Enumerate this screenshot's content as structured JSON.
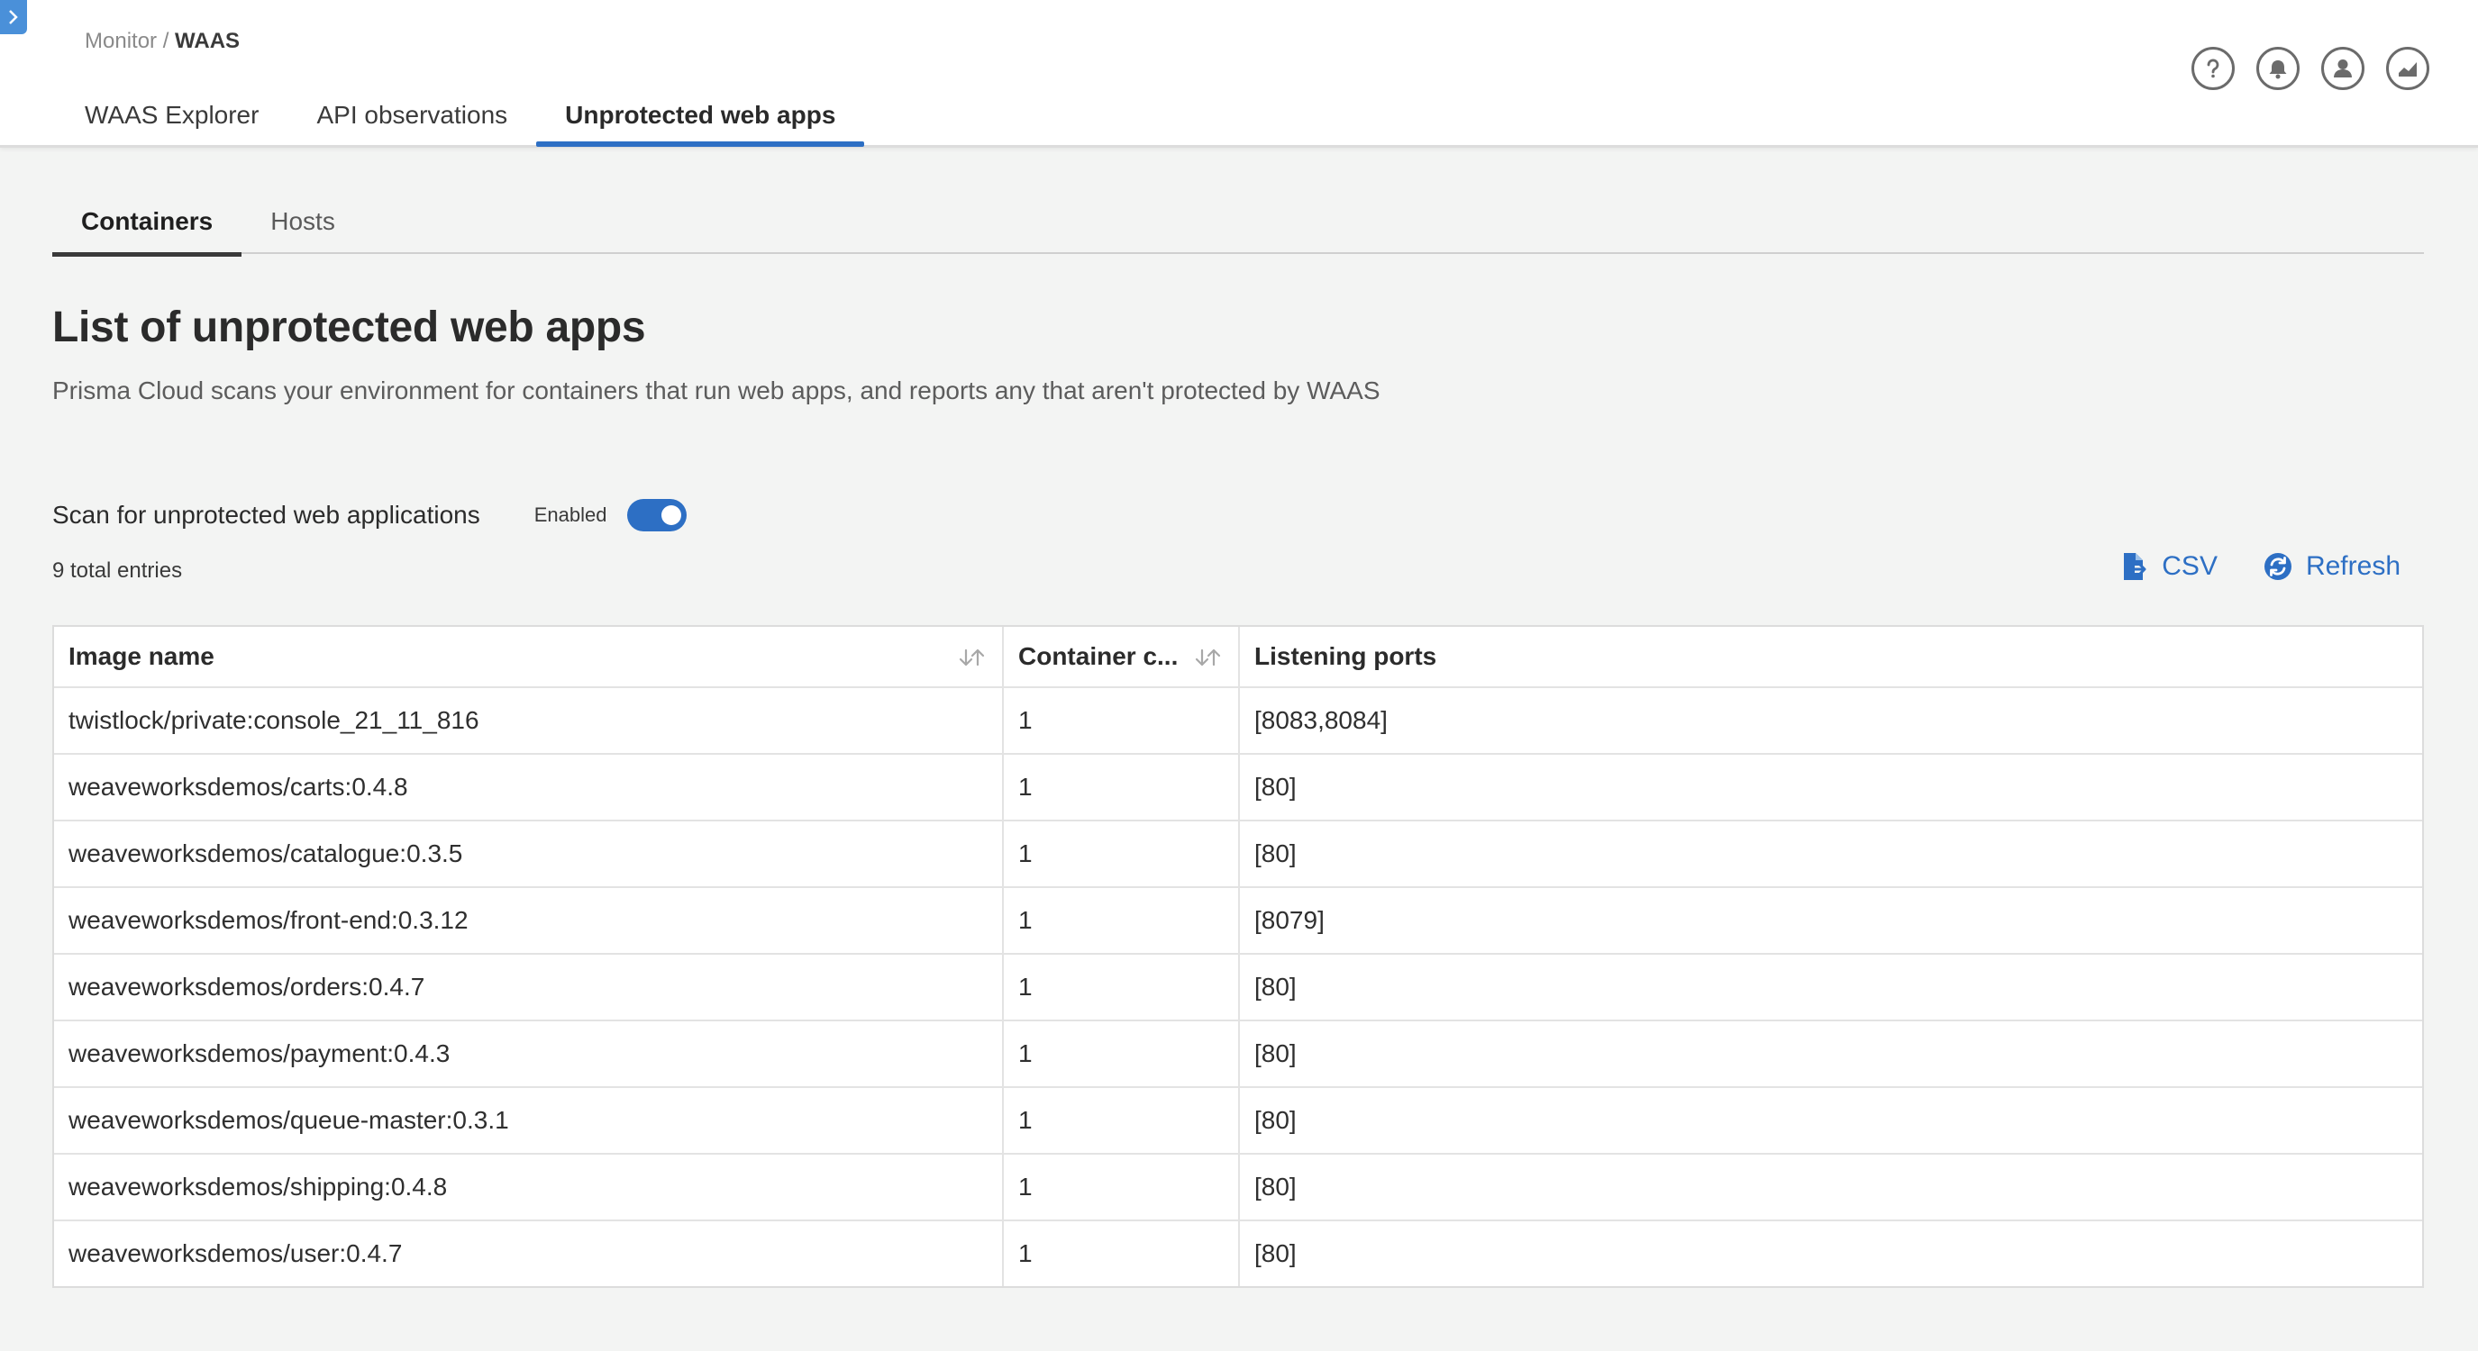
{
  "breadcrumb": {
    "parent": "Monitor / ",
    "current": "WAAS"
  },
  "main_tabs": [
    {
      "label": "WAAS Explorer",
      "active": false
    },
    {
      "label": "API observations",
      "active": false
    },
    {
      "label": "Unprotected web apps",
      "active": true
    }
  ],
  "header_icons": [
    "help-icon",
    "bell-icon",
    "user-icon",
    "chart-icon"
  ],
  "sub_tabs": [
    {
      "label": "Containers",
      "active": true
    },
    {
      "label": "Hosts",
      "active": false
    }
  ],
  "page": {
    "title": "List of unprotected web apps",
    "description": "Prisma Cloud scans your environment for containers that run web apps, and reports any that aren't protected by WAAS"
  },
  "scan": {
    "label": "Scan for unprotected web applications",
    "toggle_state": "Enabled",
    "enabled": true
  },
  "entries_text": "9 total entries",
  "actions": {
    "csv": "CSV",
    "refresh": "Refresh"
  },
  "colors": {
    "accent": "#2d6fc4",
    "nav_button": "#4a90d9"
  },
  "table": {
    "columns": [
      "Image name",
      "Container c...",
      "Listening ports"
    ],
    "rows": [
      [
        "twistlock/private:console_21_11_816",
        "1",
        "[8083,8084]"
      ],
      [
        "weaveworksdemos/carts:0.4.8",
        "1",
        "[80]"
      ],
      [
        "weaveworksdemos/catalogue:0.3.5",
        "1",
        "[80]"
      ],
      [
        "weaveworksdemos/front-end:0.3.12",
        "1",
        "[8079]"
      ],
      [
        "weaveworksdemos/orders:0.4.7",
        "1",
        "[80]"
      ],
      [
        "weaveworksdemos/payment:0.4.3",
        "1",
        "[80]"
      ],
      [
        "weaveworksdemos/queue-master:0.3.1",
        "1",
        "[80]"
      ],
      [
        "weaveworksdemos/shipping:0.4.8",
        "1",
        "[80]"
      ],
      [
        "weaveworksdemos/user:0.4.7",
        "1",
        "[80]"
      ]
    ]
  }
}
